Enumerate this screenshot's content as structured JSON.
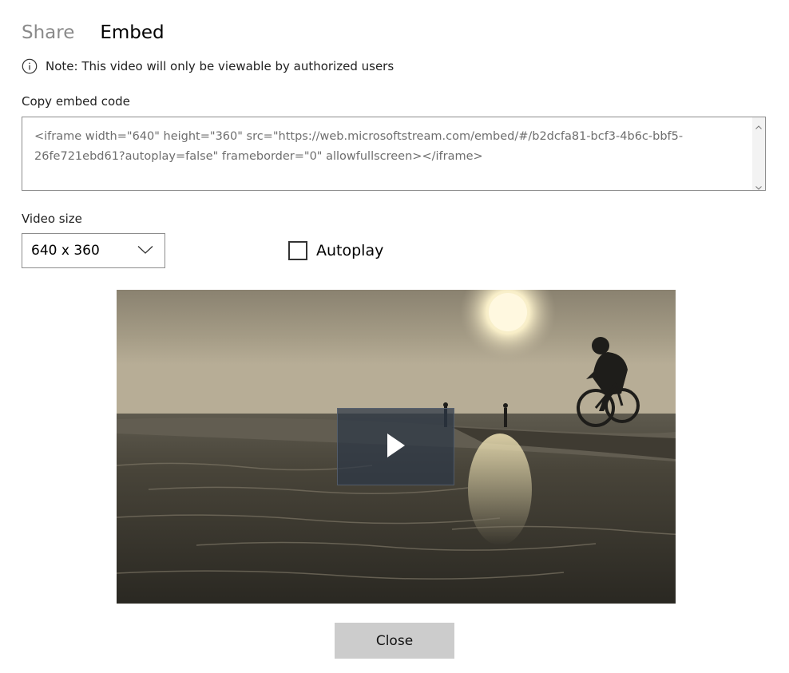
{
  "tabs": [
    {
      "label": "Share"
    },
    {
      "label": "Embed"
    }
  ],
  "note": {
    "text": "Note: This video will only be viewable by authorized users",
    "icon": "info-icon"
  },
  "embed": {
    "label": "Copy embed code",
    "code": "<iframe width=\"640\" height=\"360\" src=\"https://web.microsoftstream.com/embed/#/b2dcfa81-bcf3-4b6c-bbf5-26fe721ebd61?autoplay=false\" frameborder=\"0\" allowfullscreen></iframe>"
  },
  "video_size": {
    "label": "Video size",
    "selected": "640 x 360"
  },
  "autoplay": {
    "label": "Autoplay",
    "checked": false
  },
  "close_label": "Close",
  "colors": {
    "inactive_tab": "#8a8a8a",
    "button_bg": "#cccccc",
    "border": "#8d8d8d"
  }
}
